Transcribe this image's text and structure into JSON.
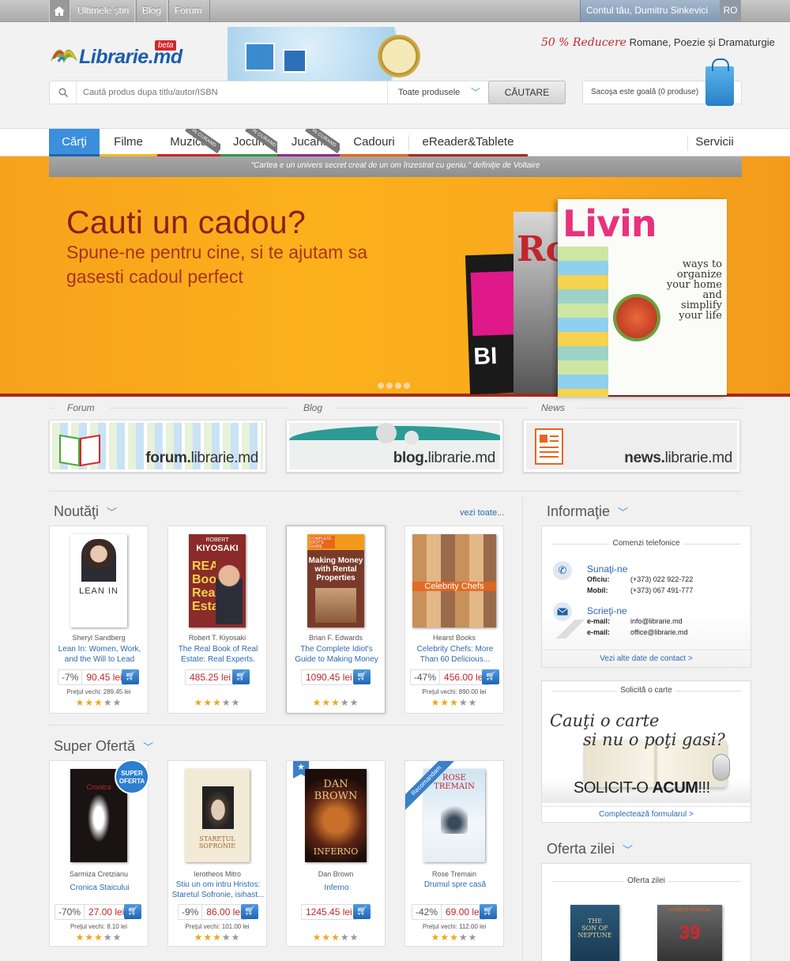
{
  "topbar": {
    "home_icon": "home-icon",
    "links": [
      "Ultimele știri",
      "Blog",
      "Forum"
    ],
    "account": "Contul tău, Dumitru Sinkevici",
    "lang": "RO"
  },
  "header": {
    "logo_text": "Librarie.md",
    "beta": "beta",
    "promo_highlight": "50 % Reducere",
    "promo_text": "Romane, Poezie și Dramaturgie"
  },
  "search": {
    "placeholder": "Cautǎ produs dupa titlu/autor/ISBN",
    "category": "Toate produsele",
    "button": "CĂUTARE"
  },
  "cart": {
    "text": "Sacoşa este goalǎ (0 produse)"
  },
  "nav": {
    "tabs": [
      {
        "label": "Cǎrţi",
        "color": "#3b8fdc"
      },
      {
        "label": "Filme",
        "color": "#f2b91c"
      },
      {
        "label": "Muzica",
        "color": "#c8262d"
      },
      {
        "label": "Jocuri",
        "color": "#2e9b4a"
      },
      {
        "label": "Jucarii",
        "color": "#8e2b8e"
      },
      {
        "label": "Cadouri",
        "color": "#e8651a"
      },
      {
        "label": "eReader&Tablete",
        "color": "#a52a1d"
      }
    ],
    "ribbon": "IN CURAND",
    "services": "Servicii"
  },
  "quote": {
    "text": "\"Cartea e un univers secret creat de un om înzestrat cu geniu.\"",
    "author": "definiţie de Voltaire"
  },
  "banner": {
    "title": "Cauti un cadou?",
    "subtitle": "Spune-ne pentru cine, si te ajutam sa gasesti cadoul perfect"
  },
  "links_section": {
    "labels": [
      "Forum",
      "Blog",
      "News"
    ],
    "cards": [
      {
        "bold": "forum.",
        "rest": "librarie.md"
      },
      {
        "bold": "blog.",
        "rest": "librarie.md"
      },
      {
        "bold": "news.",
        "rest": "librarie.md"
      }
    ]
  },
  "noutati": {
    "title": "Noutăţi",
    "see_all": "vezi toate...",
    "products": [
      {
        "author": "Sheryl Sandberg",
        "title": "Lean In: Women, Work, and the Will to Lead",
        "discount": "-7%",
        "price": "90.45 lei",
        "old": "Preţul vechi: 289.45 lei",
        "stars": 3,
        "cover_text": "LEAN IN"
      },
      {
        "author": "Robert T. Kiyosaki",
        "title": "The Real Book of Real Estate: Real Experts. Real...",
        "discount": "",
        "price": "485.25 lei",
        "old": "",
        "stars": 3,
        "cover_text": "KIYOSAKI"
      },
      {
        "author": "Brian F. Edwards",
        "title": "The Complete Idiot's Guide to Making Money",
        "discount": "",
        "price": "1090.45 lei",
        "old": "",
        "stars": 3,
        "cover_text": "Making Money with Rental Properties"
      },
      {
        "author": "Hearst Books",
        "title": "Celebrity Chefs: More Than 60 Delicious...",
        "discount": "-47%",
        "price": "456.00 lei",
        "old": "Preţul vechi: 890.00 lei",
        "stars": 3,
        "cover_text": "Celebrity Chefs"
      }
    ]
  },
  "super": {
    "title": "Super Ofertă",
    "badge": "SUPER OFERTA",
    "ribbon_recomandam": "Recomandam",
    "products": [
      {
        "author": "Sarmiza Cretzianu",
        "title": "Cronica Staicului",
        "discount": "-70%",
        "price": "27.00 lei",
        "old": "Preţul vechi: 8.10 lei",
        "stars": 3
      },
      {
        "author": "Ierotheos Mitro",
        "title": "Stiu un om intru Hristos: Staretul Sofronie, isihast...",
        "discount": "-9%",
        "price": "86.00 lei",
        "old": "Preţul vechi: 101.00 lei",
        "stars": 3,
        "cover_text": "STAREŢUL SOFRONIE"
      },
      {
        "author": "Dan Brown",
        "title": "Inferno",
        "discount": "",
        "price": "1245.45 lei",
        "old": "",
        "stars": 3,
        "cover_text": "INFERNO"
      },
      {
        "author": "Rose Tremain",
        "title": "Drumul spre casă",
        "discount": "-42%",
        "price": "69.00 lei",
        "old": "Preţul vechi: 112.00 lei",
        "stars": 3,
        "cover_text": "ROSE TREMAIN"
      }
    ]
  },
  "info": {
    "title": "Informaţie",
    "caption": "Comenzi telefonice",
    "call": "Sunaţi-ne",
    "office_label": "Oficiu:",
    "office": "(+373) 022 922-722",
    "mobile_label": "Mobil:",
    "mobile": "(+373) 067 491-777",
    "write": "Scrieţi-ne",
    "email_label": "e-mail:",
    "email1": "info@librarie.md",
    "email2": "office@librarie.md",
    "more": "Vezi alte date de contact >"
  },
  "request": {
    "caption": "Solicită o carte",
    "line1": "Cauţi o carte",
    "line2": "si nu o poţi gasi?",
    "cta": "SOLICIT-O",
    "cta_bold": "ACUM",
    "cta_end": "!!!",
    "link": "Complectează formularul >"
  },
  "offer": {
    "title": "Oferta zilei",
    "caption": "Oferta zilei"
  }
}
